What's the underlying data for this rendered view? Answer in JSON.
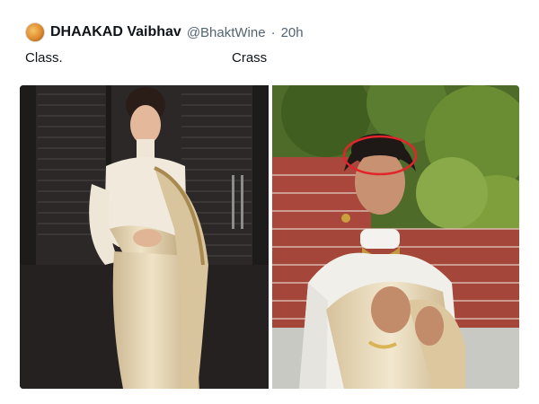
{
  "tweet": {
    "author_name": "DHAAKAD Vaibhav",
    "handle": "@BhaktWine",
    "separator": "·",
    "time": "20h",
    "caption_left": "Class.",
    "caption_right": "Crass"
  },
  "media": {
    "left_photo": "woman in cream silk saree with high-neck blouse against dark wooden shutters",
    "right_photo": "woman in white high-neck blouse and cream saree with gold choker in front of brick wall and greenery, red circle drawn on head",
    "annotation_color": "#e0262b"
  },
  "icons": {
    "avatar": "avatar-icon"
  }
}
